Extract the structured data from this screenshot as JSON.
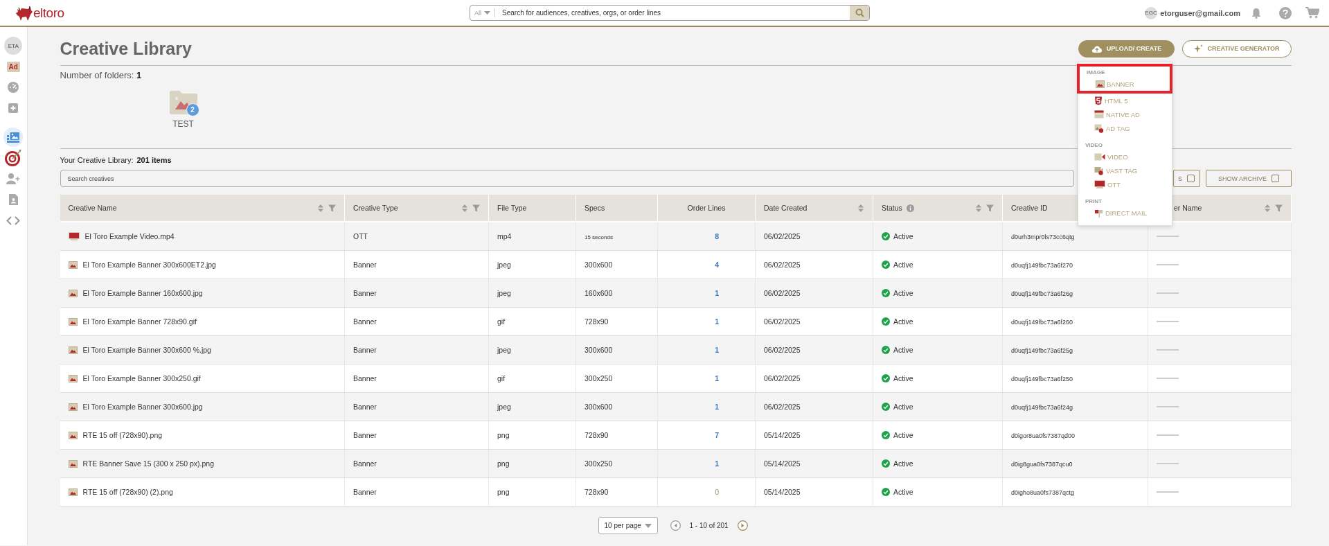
{
  "topbar": {
    "brand": "eltoro",
    "search": {
      "scope": "All",
      "placeholder": "Search for audiences, creatives, orgs, or order lines"
    },
    "user": {
      "initials": "EGC",
      "email": "etorguser@gmail.com"
    }
  },
  "sidebar": {
    "items": [
      {
        "kind": "avatar",
        "label": "ETA",
        "selected": false
      },
      {
        "kind": "ad",
        "label": "Ad",
        "selected": false
      },
      {
        "kind": "gauge",
        "selected": false
      },
      {
        "kind": "plus",
        "selected": false
      },
      {
        "kind": "gallery",
        "selected": true
      },
      {
        "kind": "target",
        "selected": false
      },
      {
        "kind": "user-add",
        "selected": false
      },
      {
        "kind": "contact",
        "selected": false
      },
      {
        "kind": "code",
        "selected": false
      }
    ]
  },
  "header": {
    "title": "Creative Library",
    "buttons": [
      {
        "label": "UPLOAD/ CREATE",
        "kind": "primary"
      },
      {
        "label": "CREATIVE GENERATOR",
        "kind": "outline"
      }
    ]
  },
  "folders": {
    "label": "Number of folders:",
    "count": "1",
    "items": [
      {
        "name": "TEST",
        "count": "2"
      }
    ]
  },
  "library": {
    "label": "Your Creative Library:",
    "count": "201 items",
    "search": {
      "placeholder": "Search creatives"
    },
    "toggles": [
      {
        "label": "S",
        "checked": false
      },
      {
        "label": "SHOW ARCHIVE",
        "checked": false
      }
    ]
  },
  "table": {
    "columns": [
      {
        "label": "Creative Name",
        "sortable": true,
        "filterable": true,
        "info": false
      },
      {
        "label": "Creative Type",
        "sortable": true,
        "filterable": true,
        "info": false
      },
      {
        "label": "File Type",
        "sortable": false,
        "filterable": false,
        "info": false
      },
      {
        "label": "Specs",
        "sortable": false,
        "filterable": false,
        "info": false
      },
      {
        "label": "Order Lines",
        "sortable": false,
        "filterable": false,
        "info": false
      },
      {
        "label": "Date Created",
        "sortable": true,
        "filterable": false,
        "info": false
      },
      {
        "label": "Status",
        "sortable": true,
        "filterable": true,
        "info": true
      },
      {
        "label": "Creative ID"
      },
      {
        "label": "er Name",
        "sortable": true,
        "filterable": true,
        "info": false
      }
    ],
    "rows": [
      {
        "kind": "ott",
        "name": "El Toro Example Video.mp4",
        "type": "OTT",
        "file_type": "mp4",
        "specs": "15 seconds",
        "order_lines": "8",
        "order_lines_disabled": false,
        "date": "06/02/2025",
        "status": {
          "label": "Active",
          "kind": "active"
        },
        "id": "d0urh3mpr0ls73cc6qtg"
      },
      {
        "kind": "banner",
        "name": "El Toro Example Banner 300x600ET2.jpg",
        "type": "Banner",
        "file_type": "jpeg",
        "specs": "300x600",
        "order_lines": "4",
        "order_lines_disabled": false,
        "date": "06/02/2025",
        "status": {
          "label": "Active",
          "kind": "active"
        },
        "id": "d0uqfj149fbc73a6f270"
      },
      {
        "kind": "banner",
        "name": "El Toro Example Banner 160x600.jpg",
        "type": "Banner",
        "file_type": "jpeg",
        "specs": "160x600",
        "order_lines": "1",
        "order_lines_disabled": false,
        "date": "06/02/2025",
        "status": {
          "label": "Active",
          "kind": "active"
        },
        "id": "d0uqfj149fbc73a6f26g"
      },
      {
        "kind": "banner",
        "name": "El Toro Example Banner 728x90.gif",
        "type": "Banner",
        "file_type": "gif",
        "specs": "728x90",
        "order_lines": "1",
        "order_lines_disabled": false,
        "date": "06/02/2025",
        "status": {
          "label": "Active",
          "kind": "active"
        },
        "id": "d0uqfj149fbc73a6f260"
      },
      {
        "kind": "banner",
        "name": "El Toro Example Banner 300x600 %.jpg",
        "type": "Banner",
        "file_type": "jpeg",
        "specs": "300x600",
        "order_lines": "1",
        "order_lines_disabled": false,
        "date": "06/02/2025",
        "status": {
          "label": "Active",
          "kind": "active"
        },
        "id": "d0uqfj149fbc73a6f25g"
      },
      {
        "kind": "banner",
        "name": "El Toro Example Banner 300x250.gif",
        "type": "Banner",
        "file_type": "gif",
        "specs": "300x250",
        "order_lines": "1",
        "order_lines_disabled": false,
        "date": "06/02/2025",
        "status": {
          "label": "Active",
          "kind": "active"
        },
        "id": "d0uqfj149fbc73a6f250"
      },
      {
        "kind": "banner",
        "name": "El Toro Example Banner 300x600.jpg",
        "type": "Banner",
        "file_type": "jpeg",
        "specs": "300x600",
        "order_lines": "1",
        "order_lines_disabled": false,
        "date": "06/02/2025",
        "status": {
          "label": "Active",
          "kind": "active"
        },
        "id": "d0uqfj149fbc73a6f24g"
      },
      {
        "kind": "banner",
        "name": "RTE 15 off (728x90).png",
        "type": "Banner",
        "file_type": "png",
        "specs": "728x90",
        "order_lines": "7",
        "order_lines_disabled": false,
        "date": "05/14/2025",
        "status": {
          "label": "Active",
          "kind": "active"
        },
        "id": "d0igor8ua0fs7387qd00"
      },
      {
        "kind": "banner",
        "name": "RTE Banner Save 15 (300 x 250 px).png",
        "type": "Banner",
        "file_type": "png",
        "specs": "300x250",
        "order_lines": "1",
        "order_lines_disabled": false,
        "date": "05/14/2025",
        "status": {
          "label": "Active",
          "kind": "active"
        },
        "id": "d0ig8gua0fs7387qcu0"
      },
      {
        "kind": "banner",
        "name": "RTE 15 off (728x90) (2).png",
        "type": "Banner",
        "file_type": "png",
        "specs": "728x90",
        "order_lines": "0",
        "order_lines_disabled": true,
        "date": "05/14/2025",
        "status": {
          "label": "Active",
          "kind": "active"
        },
        "id": "d0igho8ua0fs7387qctg"
      }
    ]
  },
  "pagination": {
    "page_size": "10 per page",
    "range": "1 - 10 of 201",
    "prev_disabled": true,
    "next_disabled": false
  },
  "upload_menu": {
    "groups": [
      {
        "label": "IMAGE",
        "items": [
          {
            "label": "BANNER",
            "kind": "banner",
            "highlighted": true
          },
          {
            "label": "HTML 5",
            "kind": "html5",
            "highlighted": false
          },
          {
            "label": "NATIVE AD",
            "kind": "native",
            "highlighted": false
          },
          {
            "label": "AD TAG",
            "kind": "adtag",
            "highlighted": false
          }
        ]
      },
      {
        "label": "VIDEO",
        "items": [
          {
            "label": "VIDEO",
            "kind": "video",
            "highlighted": false
          },
          {
            "label": "VAST TAG",
            "kind": "vast",
            "highlighted": false
          },
          {
            "label": "OTT",
            "kind": "ott",
            "highlighted": false
          }
        ]
      },
      {
        "label": "PRINT",
        "items": [
          {
            "label": "DIRECT MAIL",
            "kind": "mail",
            "highlighted": false
          }
        ]
      }
    ]
  }
}
